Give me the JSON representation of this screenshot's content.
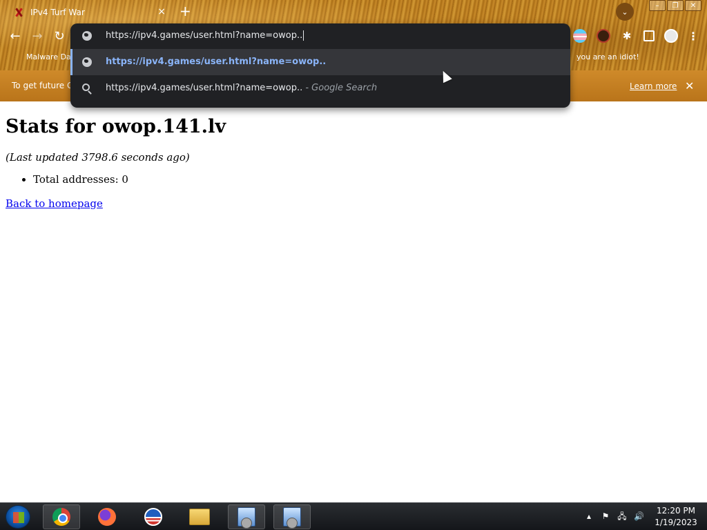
{
  "browser": {
    "tab_title": "IPv4 Turf War",
    "tab_close": "×",
    "new_tab": "+",
    "window_buttons": [
      "–",
      "❐",
      "✕"
    ],
    "nav": {
      "back": "←",
      "forward": "→",
      "reload": "↻"
    },
    "extensions_menu": "⋮",
    "puzzle": "✱",
    "bookmarks": [
      {
        "label": "Malware Dat"
      },
      {
        "label": "you are an idiot!"
      }
    ]
  },
  "omnibox": {
    "input_value": "https://ipv4.games/user.html?name=owop..",
    "suggestions": [
      {
        "text": "https://ipv4.games/user.html?name=owop..",
        "kind": "url"
      },
      {
        "text": "https://ipv4.games/user.html?name=owop..",
        "suffix": " - Google Search",
        "kind": "search"
      }
    ]
  },
  "infobar": {
    "text": "To get future G",
    "learn_more": "Learn more",
    "close": "✕"
  },
  "page": {
    "title": "Stats for owop.141.lv",
    "updated": "(Last updated 3798.6 seconds ago)",
    "stats": [
      "Total addresses: 0"
    ],
    "back_link": "Back to homepage"
  },
  "taskbar": {
    "apps": [
      "start",
      "chrome",
      "firefox",
      "obama",
      "file-explorer",
      "installer",
      "installer"
    ],
    "tray": {
      "chevron": "▴",
      "flag": "⚑",
      "network": "🖧",
      "volume": "🔊"
    },
    "time": "12:20 PM",
    "date": "1/19/2023"
  },
  "colors": {
    "omnibox_bg": "#202124",
    "suggestion_link": "#8ab4f8",
    "link": "#0000ee"
  }
}
